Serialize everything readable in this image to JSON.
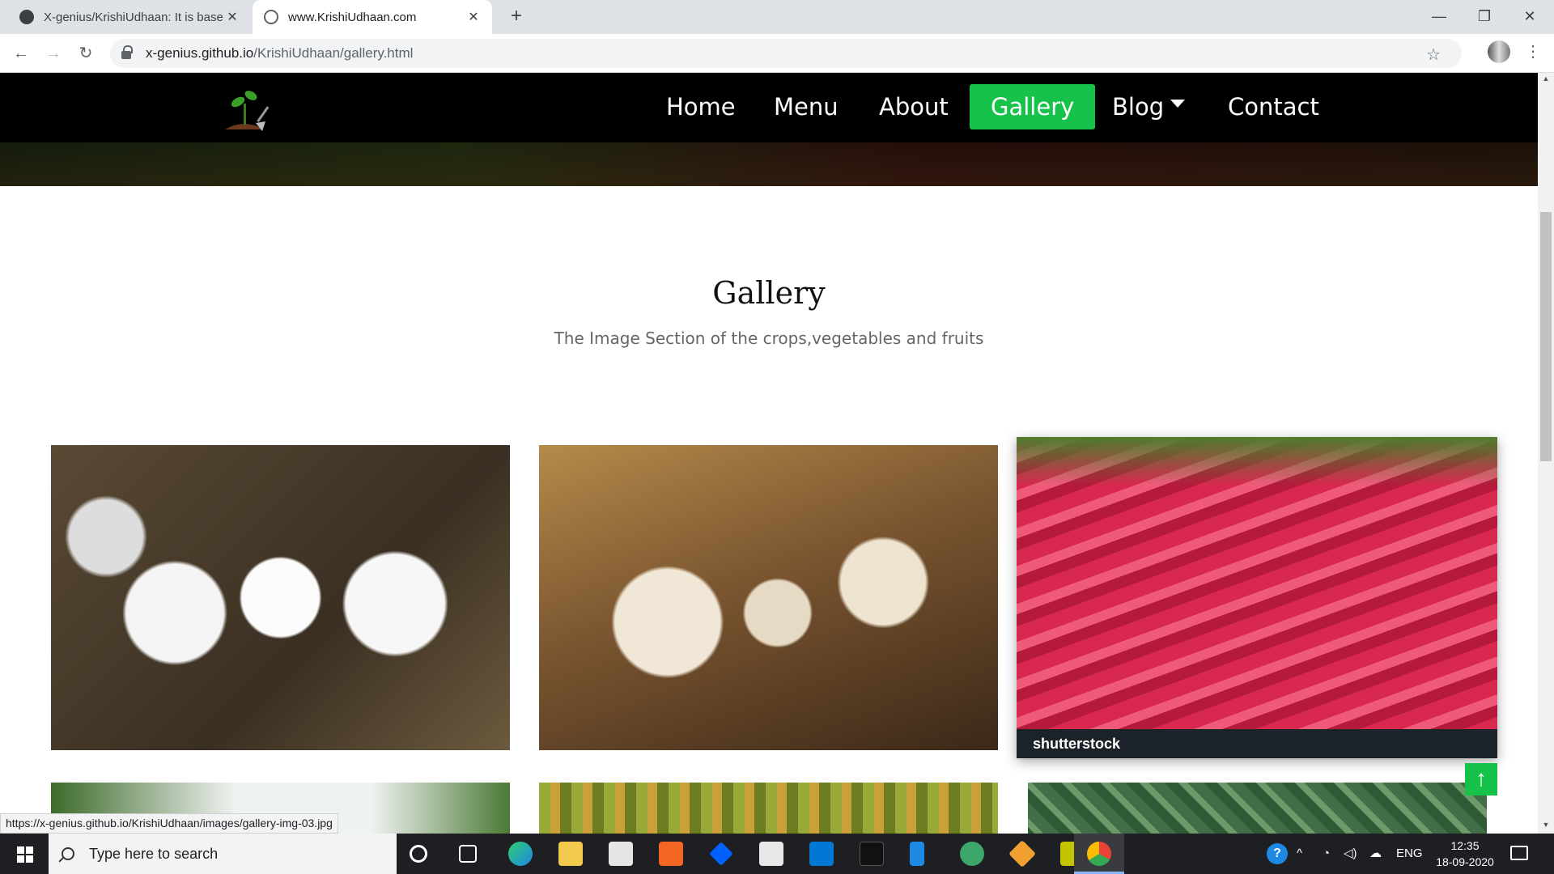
{
  "browser": {
    "tabs": [
      {
        "title": "X-genius/KrishiUdhaan: It is base",
        "active": false
      },
      {
        "title": "www.KrishiUdhaan.com",
        "active": true
      }
    ],
    "new_tab": "+",
    "window_controls": {
      "minimize": "—",
      "maximize": "❐",
      "close": "✕"
    },
    "url_host": "x-genius.github.io",
    "url_path": "/KrishiUdhaan/gallery.html",
    "status_url": "https://x-genius.github.io/KrishiUdhaan/images/gallery-img-03.jpg"
  },
  "nav": {
    "items": [
      "Home",
      "Menu",
      "About",
      "Gallery",
      "Blog",
      "Contact"
    ],
    "active": "Gallery",
    "accent_color": "#17c24a"
  },
  "gallery": {
    "title": "Gallery",
    "subtitle": "The Image Section of the crops,vegetables and fruits",
    "images": [
      "cotton",
      "garlic",
      "radish",
      "trees",
      "gourds",
      "leaves"
    ],
    "watermark_brand": "shutterstock"
  },
  "scroll_top": "↑",
  "taskbar": {
    "search_placeholder": "Type here to search",
    "language": "ENG",
    "time": "12:35",
    "date": "18-09-2020"
  }
}
